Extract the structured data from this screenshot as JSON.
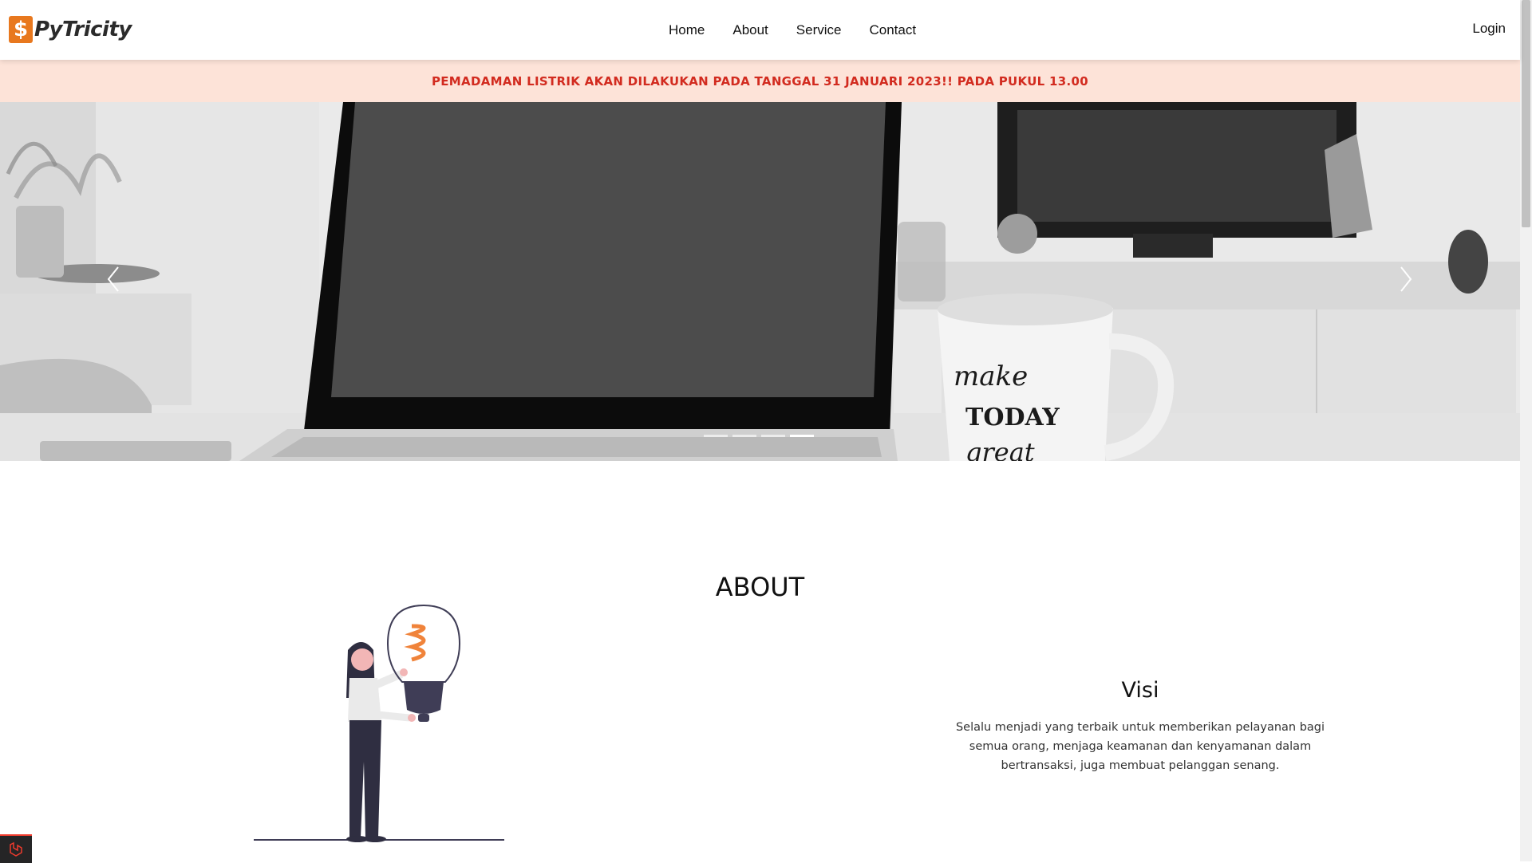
{
  "brand": {
    "icon_glyph": "$",
    "name": "PyTricity",
    "accent": "#e8781e"
  },
  "nav": {
    "items": [
      "Home",
      "About",
      "Service",
      "Contact"
    ],
    "login": "Login"
  },
  "announcement": {
    "text": "PEMADAMAN LISTRIK AKAN DILAKUKAN PADA TANGGAL 31 JANUARI 2023!! PADA PUKUL 13.00",
    "color": "#d22b1f",
    "background": "#fde3d8"
  },
  "carousel": {
    "image": "laptop-and-mug-grayscale-photo",
    "mug_text": [
      "make",
      "TODAY",
      "great"
    ],
    "prev_icon": "chevron-left-icon",
    "next_icon": "chevron-right-icon",
    "slides": 4,
    "active_slide": 4
  },
  "about": {
    "title": "ABOUT",
    "illustration": "woman-holding-lightbulb-illustration",
    "visi_title": "Visi",
    "visi_text": "Selalu menjadi yang terbaik untuk memberikan pelayanan bagi semua orang, menjaga keamanan dan kenyamanan dalam bertransaksi, juga membuat pelanggan senang."
  }
}
